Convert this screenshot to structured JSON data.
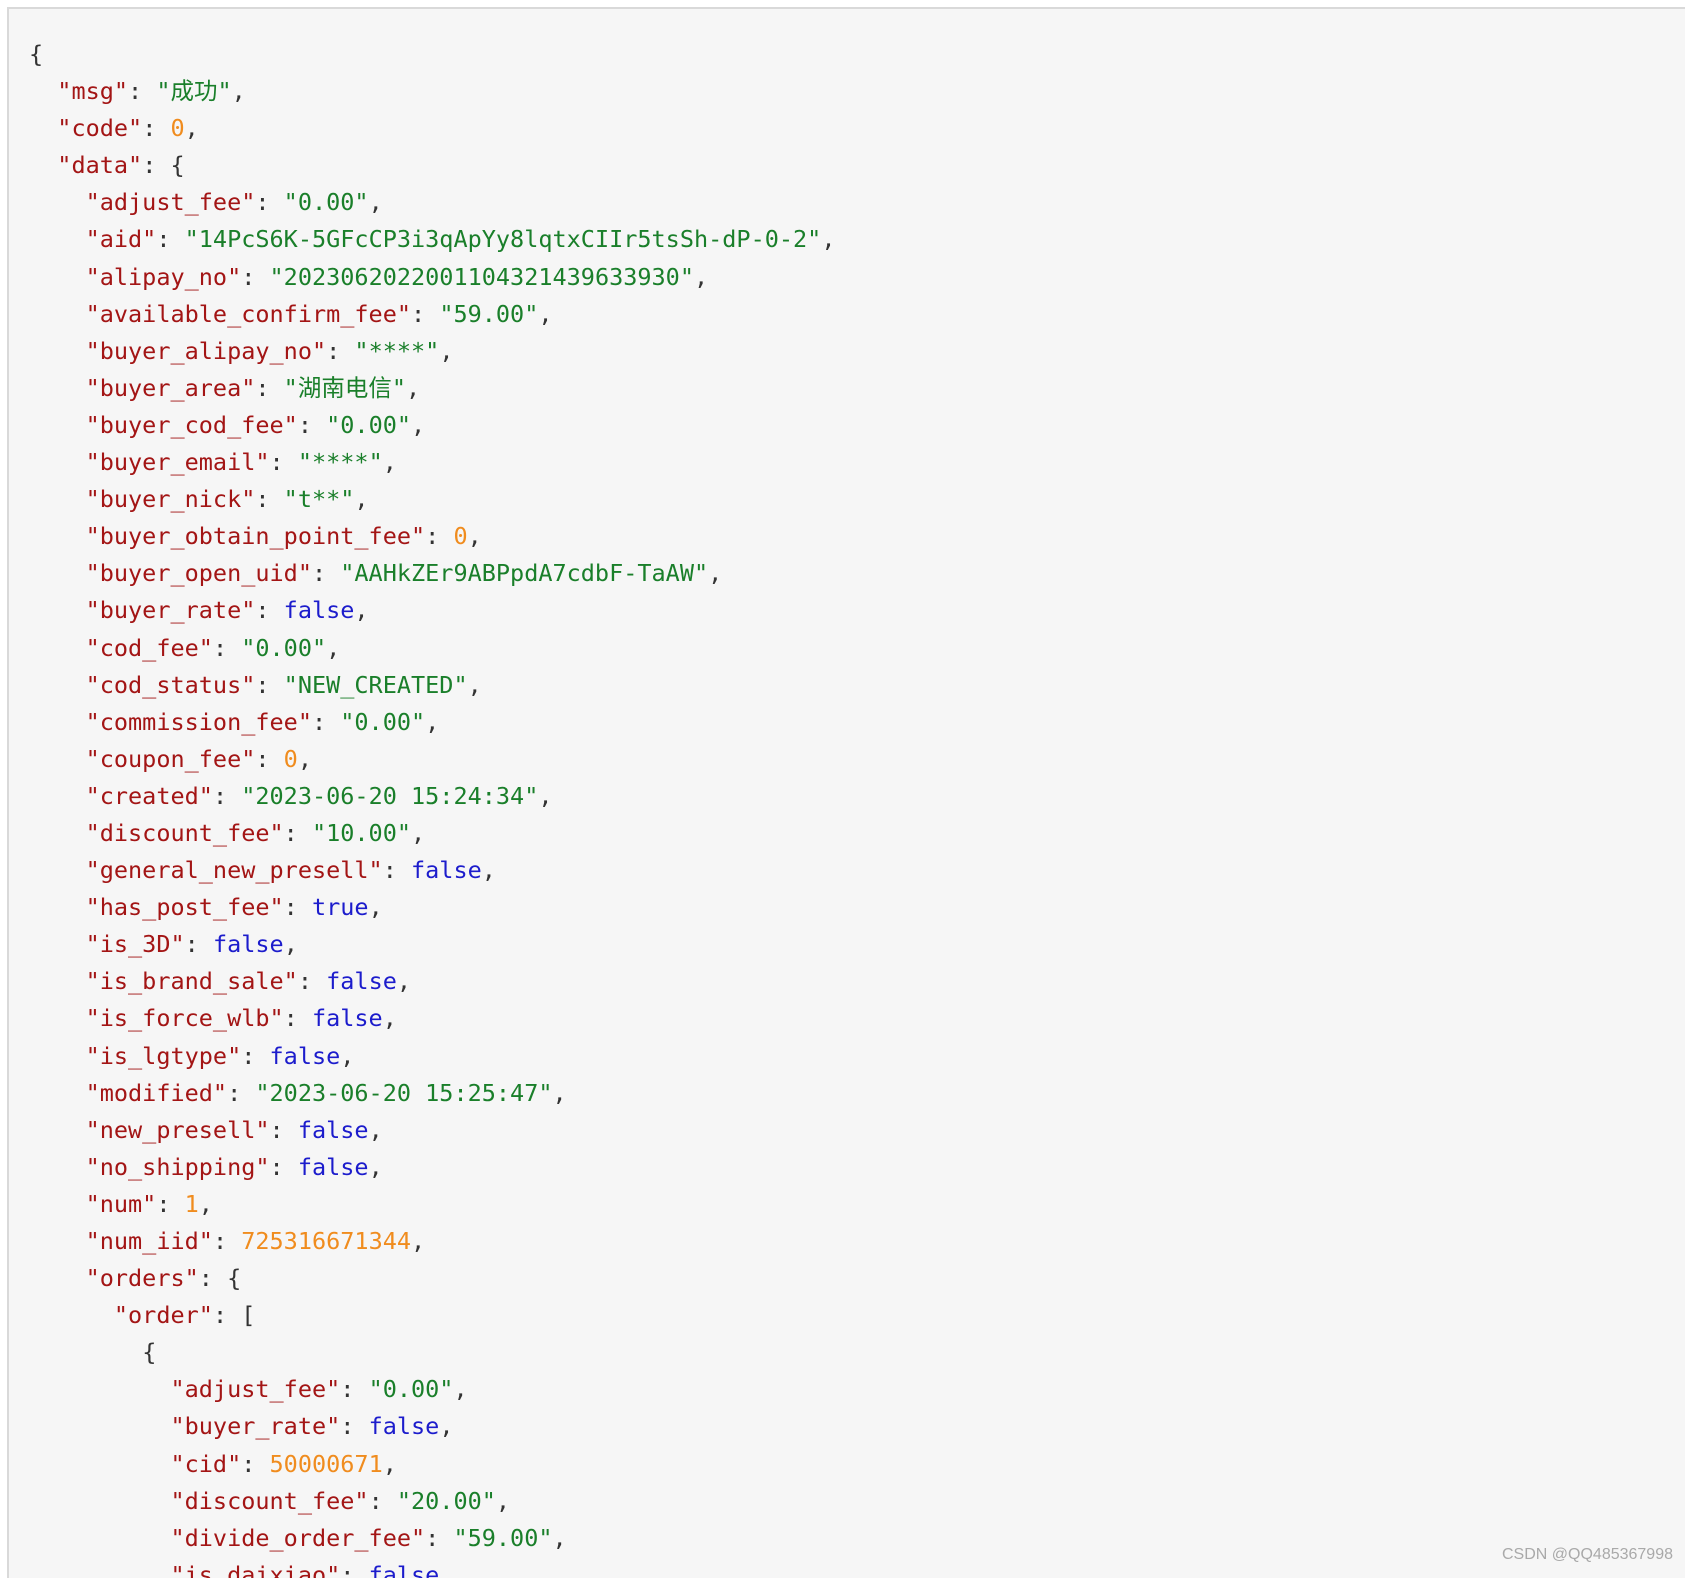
{
  "lines": [
    {
      "indent": 0,
      "parts": [
        {
          "t": "p",
          "v": "{"
        }
      ]
    },
    {
      "indent": 1,
      "parts": [
        {
          "t": "k",
          "v": "\"msg\""
        },
        {
          "t": "p",
          "v": ": "
        },
        {
          "t": "s",
          "v": "\"成功\""
        },
        {
          "t": "p",
          "v": ","
        }
      ]
    },
    {
      "indent": 1,
      "parts": [
        {
          "t": "k",
          "v": "\"code\""
        },
        {
          "t": "p",
          "v": ": "
        },
        {
          "t": "n",
          "v": "0"
        },
        {
          "t": "p",
          "v": ","
        }
      ]
    },
    {
      "indent": 1,
      "parts": [
        {
          "t": "k",
          "v": "\"data\""
        },
        {
          "t": "p",
          "v": ": {"
        }
      ]
    },
    {
      "indent": 2,
      "parts": [
        {
          "t": "k",
          "v": "\"adjust_fee\""
        },
        {
          "t": "p",
          "v": ": "
        },
        {
          "t": "s",
          "v": "\"0.00\""
        },
        {
          "t": "p",
          "v": ","
        }
      ]
    },
    {
      "indent": 2,
      "parts": [
        {
          "t": "k",
          "v": "\"aid\""
        },
        {
          "t": "p",
          "v": ": "
        },
        {
          "t": "s",
          "v": "\"14PcS6K-5GFcCP3i3qApYy8lqtxCIIr5tsSh-dP-0-2\""
        },
        {
          "t": "p",
          "v": ","
        }
      ]
    },
    {
      "indent": 2,
      "parts": [
        {
          "t": "k",
          "v": "\"alipay_no\""
        },
        {
          "t": "p",
          "v": ": "
        },
        {
          "t": "s",
          "v": "\"2023062022001104321439633930\""
        },
        {
          "t": "p",
          "v": ","
        }
      ]
    },
    {
      "indent": 2,
      "parts": [
        {
          "t": "k",
          "v": "\"available_confirm_fee\""
        },
        {
          "t": "p",
          "v": ": "
        },
        {
          "t": "s",
          "v": "\"59.00\""
        },
        {
          "t": "p",
          "v": ","
        }
      ]
    },
    {
      "indent": 2,
      "parts": [
        {
          "t": "k",
          "v": "\"buyer_alipay_no\""
        },
        {
          "t": "p",
          "v": ": "
        },
        {
          "t": "s",
          "v": "\"****\""
        },
        {
          "t": "p",
          "v": ","
        }
      ]
    },
    {
      "indent": 2,
      "parts": [
        {
          "t": "k",
          "v": "\"buyer_area\""
        },
        {
          "t": "p",
          "v": ": "
        },
        {
          "t": "s",
          "v": "\"湖南电信\""
        },
        {
          "t": "p",
          "v": ","
        }
      ]
    },
    {
      "indent": 2,
      "parts": [
        {
          "t": "k",
          "v": "\"buyer_cod_fee\""
        },
        {
          "t": "p",
          "v": ": "
        },
        {
          "t": "s",
          "v": "\"0.00\""
        },
        {
          "t": "p",
          "v": ","
        }
      ]
    },
    {
      "indent": 2,
      "parts": [
        {
          "t": "k",
          "v": "\"buyer_email\""
        },
        {
          "t": "p",
          "v": ": "
        },
        {
          "t": "s",
          "v": "\"****\""
        },
        {
          "t": "p",
          "v": ","
        }
      ]
    },
    {
      "indent": 2,
      "parts": [
        {
          "t": "k",
          "v": "\"buyer_nick\""
        },
        {
          "t": "p",
          "v": ": "
        },
        {
          "t": "s",
          "v": "\"t**\""
        },
        {
          "t": "p",
          "v": ","
        }
      ]
    },
    {
      "indent": 2,
      "parts": [
        {
          "t": "k",
          "v": "\"buyer_obtain_point_fee\""
        },
        {
          "t": "p",
          "v": ": "
        },
        {
          "t": "n",
          "v": "0"
        },
        {
          "t": "p",
          "v": ","
        }
      ]
    },
    {
      "indent": 2,
      "parts": [
        {
          "t": "k",
          "v": "\"buyer_open_uid\""
        },
        {
          "t": "p",
          "v": ": "
        },
        {
          "t": "s",
          "v": "\"AAHkZEr9ABPpdA7cdbF-TaAW\""
        },
        {
          "t": "p",
          "v": ","
        }
      ]
    },
    {
      "indent": 2,
      "parts": [
        {
          "t": "k",
          "v": "\"buyer_rate\""
        },
        {
          "t": "p",
          "v": ": "
        },
        {
          "t": "b",
          "v": "false"
        },
        {
          "t": "p",
          "v": ","
        }
      ]
    },
    {
      "indent": 2,
      "parts": [
        {
          "t": "k",
          "v": "\"cod_fee\""
        },
        {
          "t": "p",
          "v": ": "
        },
        {
          "t": "s",
          "v": "\"0.00\""
        },
        {
          "t": "p",
          "v": ","
        }
      ]
    },
    {
      "indent": 2,
      "parts": [
        {
          "t": "k",
          "v": "\"cod_status\""
        },
        {
          "t": "p",
          "v": ": "
        },
        {
          "t": "s",
          "v": "\"NEW_CREATED\""
        },
        {
          "t": "p",
          "v": ","
        }
      ]
    },
    {
      "indent": 2,
      "parts": [
        {
          "t": "k",
          "v": "\"commission_fee\""
        },
        {
          "t": "p",
          "v": ": "
        },
        {
          "t": "s",
          "v": "\"0.00\""
        },
        {
          "t": "p",
          "v": ","
        }
      ]
    },
    {
      "indent": 2,
      "parts": [
        {
          "t": "k",
          "v": "\"coupon_fee\""
        },
        {
          "t": "p",
          "v": ": "
        },
        {
          "t": "n",
          "v": "0"
        },
        {
          "t": "p",
          "v": ","
        }
      ]
    },
    {
      "indent": 2,
      "parts": [
        {
          "t": "k",
          "v": "\"created\""
        },
        {
          "t": "p",
          "v": ": "
        },
        {
          "t": "s",
          "v": "\"2023-06-20 15:24:34\""
        },
        {
          "t": "p",
          "v": ","
        }
      ]
    },
    {
      "indent": 2,
      "parts": [
        {
          "t": "k",
          "v": "\"discount_fee\""
        },
        {
          "t": "p",
          "v": ": "
        },
        {
          "t": "s",
          "v": "\"10.00\""
        },
        {
          "t": "p",
          "v": ","
        }
      ]
    },
    {
      "indent": 2,
      "parts": [
        {
          "t": "k",
          "v": "\"general_new_presell\""
        },
        {
          "t": "p",
          "v": ": "
        },
        {
          "t": "b",
          "v": "false"
        },
        {
          "t": "p",
          "v": ","
        }
      ]
    },
    {
      "indent": 2,
      "parts": [
        {
          "t": "k",
          "v": "\"has_post_fee\""
        },
        {
          "t": "p",
          "v": ": "
        },
        {
          "t": "b",
          "v": "true"
        },
        {
          "t": "p",
          "v": ","
        }
      ]
    },
    {
      "indent": 2,
      "parts": [
        {
          "t": "k",
          "v": "\"is_3D\""
        },
        {
          "t": "p",
          "v": ": "
        },
        {
          "t": "b",
          "v": "false"
        },
        {
          "t": "p",
          "v": ","
        }
      ]
    },
    {
      "indent": 2,
      "parts": [
        {
          "t": "k",
          "v": "\"is_brand_sale\""
        },
        {
          "t": "p",
          "v": ": "
        },
        {
          "t": "b",
          "v": "false"
        },
        {
          "t": "p",
          "v": ","
        }
      ]
    },
    {
      "indent": 2,
      "parts": [
        {
          "t": "k",
          "v": "\"is_force_wlb\""
        },
        {
          "t": "p",
          "v": ": "
        },
        {
          "t": "b",
          "v": "false"
        },
        {
          "t": "p",
          "v": ","
        }
      ]
    },
    {
      "indent": 2,
      "parts": [
        {
          "t": "k",
          "v": "\"is_lgtype\""
        },
        {
          "t": "p",
          "v": ": "
        },
        {
          "t": "b",
          "v": "false"
        },
        {
          "t": "p",
          "v": ","
        }
      ]
    },
    {
      "indent": 2,
      "parts": [
        {
          "t": "k",
          "v": "\"modified\""
        },
        {
          "t": "p",
          "v": ": "
        },
        {
          "t": "s",
          "v": "\"2023-06-20 15:25:47\""
        },
        {
          "t": "p",
          "v": ","
        }
      ]
    },
    {
      "indent": 2,
      "parts": [
        {
          "t": "k",
          "v": "\"new_presell\""
        },
        {
          "t": "p",
          "v": ": "
        },
        {
          "t": "b",
          "v": "false"
        },
        {
          "t": "p",
          "v": ","
        }
      ]
    },
    {
      "indent": 2,
      "parts": [
        {
          "t": "k",
          "v": "\"no_shipping\""
        },
        {
          "t": "p",
          "v": ": "
        },
        {
          "t": "b",
          "v": "false"
        },
        {
          "t": "p",
          "v": ","
        }
      ]
    },
    {
      "indent": 2,
      "parts": [
        {
          "t": "k",
          "v": "\"num\""
        },
        {
          "t": "p",
          "v": ": "
        },
        {
          "t": "n",
          "v": "1"
        },
        {
          "t": "p",
          "v": ","
        }
      ]
    },
    {
      "indent": 2,
      "parts": [
        {
          "t": "k",
          "v": "\"num_iid\""
        },
        {
          "t": "p",
          "v": ": "
        },
        {
          "t": "n",
          "v": "725316671344"
        },
        {
          "t": "p",
          "v": ","
        }
      ]
    },
    {
      "indent": 2,
      "parts": [
        {
          "t": "k",
          "v": "\"orders\""
        },
        {
          "t": "p",
          "v": ": {"
        }
      ]
    },
    {
      "indent": 3,
      "parts": [
        {
          "t": "k",
          "v": "\"order\""
        },
        {
          "t": "p",
          "v": ": ["
        }
      ]
    },
    {
      "indent": 4,
      "parts": [
        {
          "t": "p",
          "v": "{"
        }
      ]
    },
    {
      "indent": 5,
      "parts": [
        {
          "t": "k",
          "v": "\"adjust_fee\""
        },
        {
          "t": "p",
          "v": ": "
        },
        {
          "t": "s",
          "v": "\"0.00\""
        },
        {
          "t": "p",
          "v": ","
        }
      ]
    },
    {
      "indent": 5,
      "parts": [
        {
          "t": "k",
          "v": "\"buyer_rate\""
        },
        {
          "t": "p",
          "v": ": "
        },
        {
          "t": "b",
          "v": "false"
        },
        {
          "t": "p",
          "v": ","
        }
      ]
    },
    {
      "indent": 5,
      "parts": [
        {
          "t": "k",
          "v": "\"cid\""
        },
        {
          "t": "p",
          "v": ": "
        },
        {
          "t": "n",
          "v": "50000671"
        },
        {
          "t": "p",
          "v": ","
        }
      ]
    },
    {
      "indent": 5,
      "parts": [
        {
          "t": "k",
          "v": "\"discount_fee\""
        },
        {
          "t": "p",
          "v": ": "
        },
        {
          "t": "s",
          "v": "\"20.00\""
        },
        {
          "t": "p",
          "v": ","
        }
      ]
    },
    {
      "indent": 5,
      "parts": [
        {
          "t": "k",
          "v": "\"divide_order_fee\""
        },
        {
          "t": "p",
          "v": ": "
        },
        {
          "t": "s",
          "v": "\"59.00\""
        },
        {
          "t": "p",
          "v": ","
        }
      ]
    },
    {
      "indent": 5,
      "parts": [
        {
          "t": "k",
          "v": "\"is_daixiao\""
        },
        {
          "t": "p",
          "v": ": "
        },
        {
          "t": "b",
          "v": "false"
        },
        {
          "t": "p",
          "v": ","
        }
      ]
    }
  ],
  "watermark": "CSDN @QQ485367998",
  "colors": {
    "key": "#a31515",
    "string": "#1a7f2a",
    "number": "#f08c1e",
    "boolean": "#1c1ccc",
    "punctuation": "#333333",
    "background": "#f6f6f6"
  }
}
